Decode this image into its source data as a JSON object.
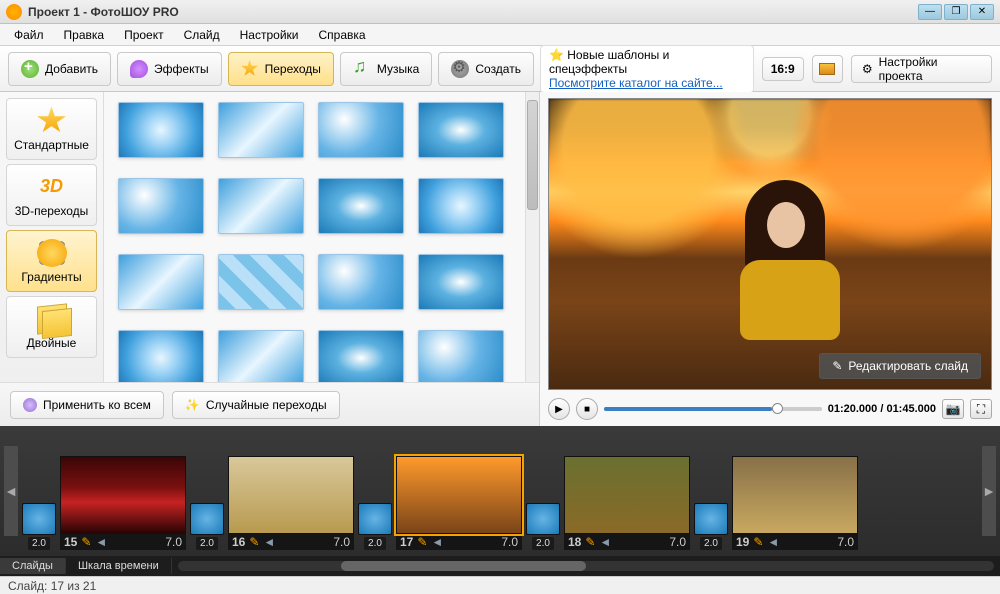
{
  "window": {
    "title": "Проект 1 - ФотоШОУ PRO"
  },
  "menu": {
    "file": "Файл",
    "edit": "Правка",
    "project": "Проект",
    "slide": "Слайд",
    "settings": "Настройки",
    "help": "Справка"
  },
  "tabs": {
    "add": "Добавить",
    "effects": "Эффекты",
    "transitions": "Переходы",
    "music": "Музыка",
    "create": "Создать"
  },
  "promo": {
    "line1": "Новые шаблоны и спецэффекты",
    "line2": "Посмотрите каталог на сайте..."
  },
  "ratio": "16:9",
  "proj_settings": "Настройки проекта",
  "categories": {
    "standard": "Стандартные",
    "threed": "3D-переходы",
    "gradients": "Градиенты",
    "double": "Двойные"
  },
  "buttons": {
    "apply_all": "Применить ко всем",
    "random": "Случайные переходы",
    "edit_slide": "Редактировать слайд"
  },
  "playback": {
    "time": "01:20.000 / 01:45.000"
  },
  "timeline": {
    "transitions": [
      "2.0",
      "2.0",
      "2.0",
      "2.0",
      "2.0"
    ],
    "slides": [
      {
        "num": "15",
        "dur": "7.0",
        "cls": "red"
      },
      {
        "num": "16",
        "dur": "7.0",
        "cls": "frame"
      },
      {
        "num": "17",
        "dur": "7.0",
        "cls": "autumn",
        "active": true
      },
      {
        "num": "18",
        "dur": "7.0",
        "cls": "wreath"
      },
      {
        "num": "19",
        "dur": "7.0",
        "cls": "park"
      }
    ],
    "tabs": {
      "slides": "Слайды",
      "timescale": "Шкала времени"
    }
  },
  "status": "Слайд: 17 из 21"
}
